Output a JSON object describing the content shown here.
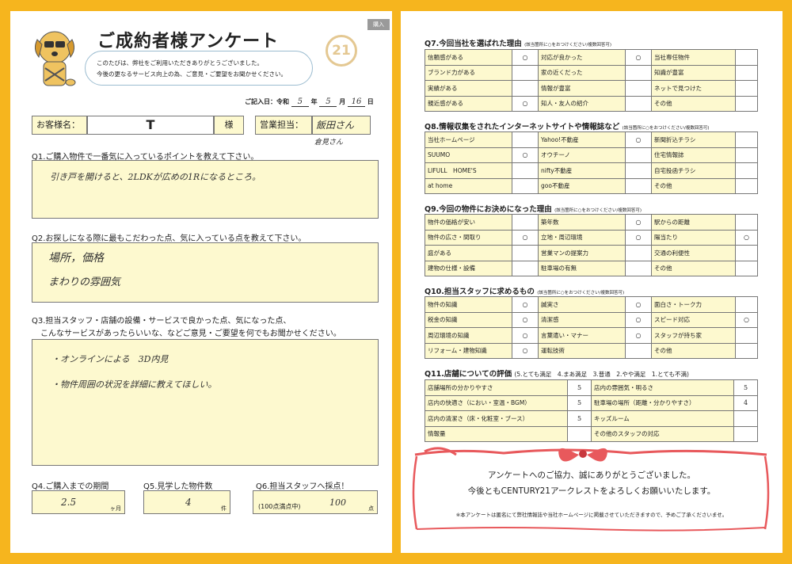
{
  "header": {
    "title": "ご成約者様アンケート",
    "intro_line1": "このたびは、弊社をご利用いただきありがとうございました。",
    "intro_line2": "今後の更なるサービス向上の為、ご意見・ご要望をお聞かせください。",
    "logo_text": "21",
    "tag": "購入"
  },
  "date": {
    "label": "ご記入日：令和",
    "year": "5",
    "year_unit": "年",
    "month": "5",
    "month_unit": "月",
    "day": "16",
    "day_unit": "日"
  },
  "customer": {
    "label": "お客様名：",
    "name": "T",
    "suffix": "様"
  },
  "sales": {
    "label": "営業担当：",
    "name1": "飯田さん",
    "name2": "倉見さん"
  },
  "q1": {
    "label": "Q1.ご購入物件で一番気に入っているポイントを教えて下さい。",
    "answer": "引き戸を開けると、2LDKが広めの1Rになるところ。"
  },
  "q2": {
    "label": "Q2.お探しになる際に最もこだわった点、気に入っている点を教えて下さい。",
    "answer1": "場所，価格",
    "answer2": "まわりの雰囲気"
  },
  "q3": {
    "label1": "Q3.担当スタッフ・店舗の設備・サービスで良かった点、気になった点、",
    "label2": "こんなサービスがあったらいいな、などご意見・ご要望を何でもお聞かせください。",
    "answer1": "・オンラインによる　3D内見",
    "answer2": "・物件周囲の状況を詳細に教えてほしい。"
  },
  "q4": {
    "label": "Q4.ご購入までの期間",
    "value": "2.5",
    "unit": "ヶ月"
  },
  "q5": {
    "label": "Q5.見学した物件数",
    "value": "4",
    "unit": "件"
  },
  "q6": {
    "label": "Q6.担当スタッフへ採点！",
    "prefix": "(100点満点中)",
    "value": "100",
    "unit": "点"
  },
  "q7": {
    "title": "Q7.今回当社を選ばれた理由",
    "note": "(該当箇所に○をおつけください/複数回答可)",
    "rows": [
      [
        {
          "l": "信頼感がある",
          "m": "○"
        },
        {
          "l": "対応が良かった",
          "m": "○"
        },
        {
          "l": "当社専任物件",
          "m": ""
        }
      ],
      [
        {
          "l": "ブランド力がある",
          "m": ""
        },
        {
          "l": "家の近くだった",
          "m": ""
        },
        {
          "l": "知識が豊富",
          "m": ""
        }
      ],
      [
        {
          "l": "実績がある",
          "m": ""
        },
        {
          "l": "情報が豊富",
          "m": ""
        },
        {
          "l": "ネットで見つけた",
          "m": ""
        }
      ],
      [
        {
          "l": "親近感がある",
          "m": "○"
        },
        {
          "l": "知人・友人の紹介",
          "m": ""
        },
        {
          "l": "その他",
          "m": ""
        }
      ]
    ]
  },
  "q8": {
    "title": "Q8.情報収集をされたインターネットサイトや情報誌など",
    "note": "(該当箇所に○をおつけください/複数回答可)",
    "rows": [
      [
        {
          "l": "当社ホームページ",
          "m": ""
        },
        {
          "l": "Yahoo!不動産",
          "m": "○"
        },
        {
          "l": "新聞折込チラシ",
          "m": ""
        }
      ],
      [
        {
          "l": "SUUMO",
          "m": "○"
        },
        {
          "l": "オウチーノ",
          "m": ""
        },
        {
          "l": "住宅情報誌",
          "m": ""
        }
      ],
      [
        {
          "l": "LIFULL　HOME'S",
          "m": ""
        },
        {
          "l": "nifty不動産",
          "m": ""
        },
        {
          "l": "自宅投函チラシ",
          "m": ""
        }
      ],
      [
        {
          "l": "at home",
          "m": ""
        },
        {
          "l": "goo不動産",
          "m": ""
        },
        {
          "l": "その他",
          "m": ""
        }
      ]
    ]
  },
  "q9": {
    "title": "Q9.今回の物件にお決めになった理由",
    "note": "(該当箇所に○をおつけください/複数回答可)",
    "rows": [
      [
        {
          "l": "物件の価格が安い",
          "m": ""
        },
        {
          "l": "築年数",
          "m": "○"
        },
        {
          "l": "駅からの距離",
          "m": ""
        }
      ],
      [
        {
          "l": "物件の広さ・間取り",
          "m": "○"
        },
        {
          "l": "立地・周辺環境",
          "m": "○"
        },
        {
          "l": "陽当たり",
          "m": "○"
        }
      ],
      [
        {
          "l": "庭がある",
          "m": ""
        },
        {
          "l": "営業マンの提案力",
          "m": ""
        },
        {
          "l": "交通の利便性",
          "m": ""
        }
      ],
      [
        {
          "l": "建物の仕様・設備",
          "m": ""
        },
        {
          "l": "駐車場の有無",
          "m": ""
        },
        {
          "l": "その他",
          "m": ""
        }
      ]
    ]
  },
  "q10": {
    "title": "Q10.担当スタッフに求めるもの",
    "note": "(該当箇所に○をおつけください/複数回答可)",
    "rows": [
      [
        {
          "l": "物件の知識",
          "m": "○"
        },
        {
          "l": "誠実さ",
          "m": "○"
        },
        {
          "l": "面白さ・トーク力",
          "m": ""
        }
      ],
      [
        {
          "l": "税金の知識",
          "m": "○"
        },
        {
          "l": "清潔感",
          "m": "○"
        },
        {
          "l": "スピード対応",
          "m": "○"
        }
      ],
      [
        {
          "l": "周辺環境の知識",
          "m": "○"
        },
        {
          "l": "言葉遣い・マナー",
          "m": "○"
        },
        {
          "l": "スタッフが持ち家",
          "m": ""
        }
      ],
      [
        {
          "l": "リフォーム・建物知識",
          "m": "○"
        },
        {
          "l": "運転技術",
          "m": ""
        },
        {
          "l": "その他",
          "m": ""
        }
      ]
    ]
  },
  "q11": {
    "title": "Q11.店舗についての評価",
    "scale": "(5.とても満足　4.まあ満足　3.普通　2.やや満足　1.とても不満)",
    "rows": [
      [
        {
          "l": "店舗場所の分かりやすさ",
          "m": "5"
        },
        {
          "l": "店内の雰囲気・明るさ",
          "m": "5"
        }
      ],
      [
        {
          "l": "店内の快適さ（におい・室温・BGM）",
          "m": "5"
        },
        {
          "l": "駐車場の場所（距離・分かりやすさ）",
          "m": "4"
        }
      ],
      [
        {
          "l": "店内の清潔さ（床・化粧室・ブース）",
          "m": "5"
        },
        {
          "l": "キッズルーム",
          "m": ""
        }
      ],
      [
        {
          "l": "情報量",
          "m": ""
        },
        {
          "l": "その他のスタッフの対応",
          "m": ""
        }
      ]
    ]
  },
  "footer": {
    "line1": "アンケートへのご協力、誠にありがとうございました。",
    "line2": "今後ともCENTURY21アークレストをよろしくお願いいたします。",
    "note": "※本アンケートは匿名にて弊社情報誌や当社ホームページに掲載させていただきますので、予めご了承くださいませ。"
  },
  "colors": {
    "frame": "#F6B51E",
    "field": "#FDF9CF",
    "ribbon": "#E8595C",
    "logo": "#E4C892"
  },
  "icons": [
    "dog-mascot-icon",
    "century21-logo-icon",
    "red-ribbon-icon"
  ]
}
